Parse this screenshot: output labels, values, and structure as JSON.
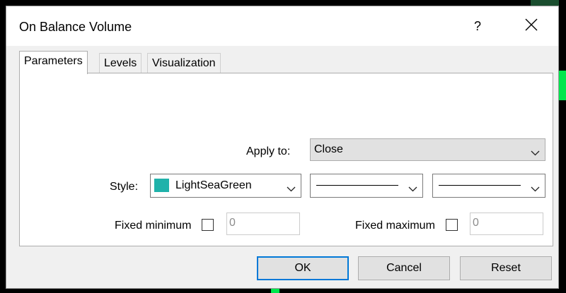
{
  "window": {
    "title": "On Balance Volume",
    "help_label": "?"
  },
  "tabs": [
    {
      "label": "Parameters",
      "active": true
    },
    {
      "label": "Levels",
      "active": false
    },
    {
      "label": "Visualization",
      "active": false
    }
  ],
  "apply_to": {
    "label": "Apply to:",
    "value": "Close"
  },
  "style": {
    "label": "Style:",
    "color_name": "LightSeaGreen",
    "color_hex": "#20b2aa",
    "line_style": "solid",
    "line_width": "thin"
  },
  "fixed_minimum": {
    "label": "Fixed minimum",
    "checked": false,
    "value": "0"
  },
  "fixed_maximum": {
    "label": "Fixed maximum",
    "checked": false,
    "value": "0"
  },
  "buttons": {
    "ok": "OK",
    "cancel": "Cancel",
    "reset": "Reset"
  },
  "icons": {
    "close": "close-icon",
    "dropdown": "chevron-down-icon"
  }
}
